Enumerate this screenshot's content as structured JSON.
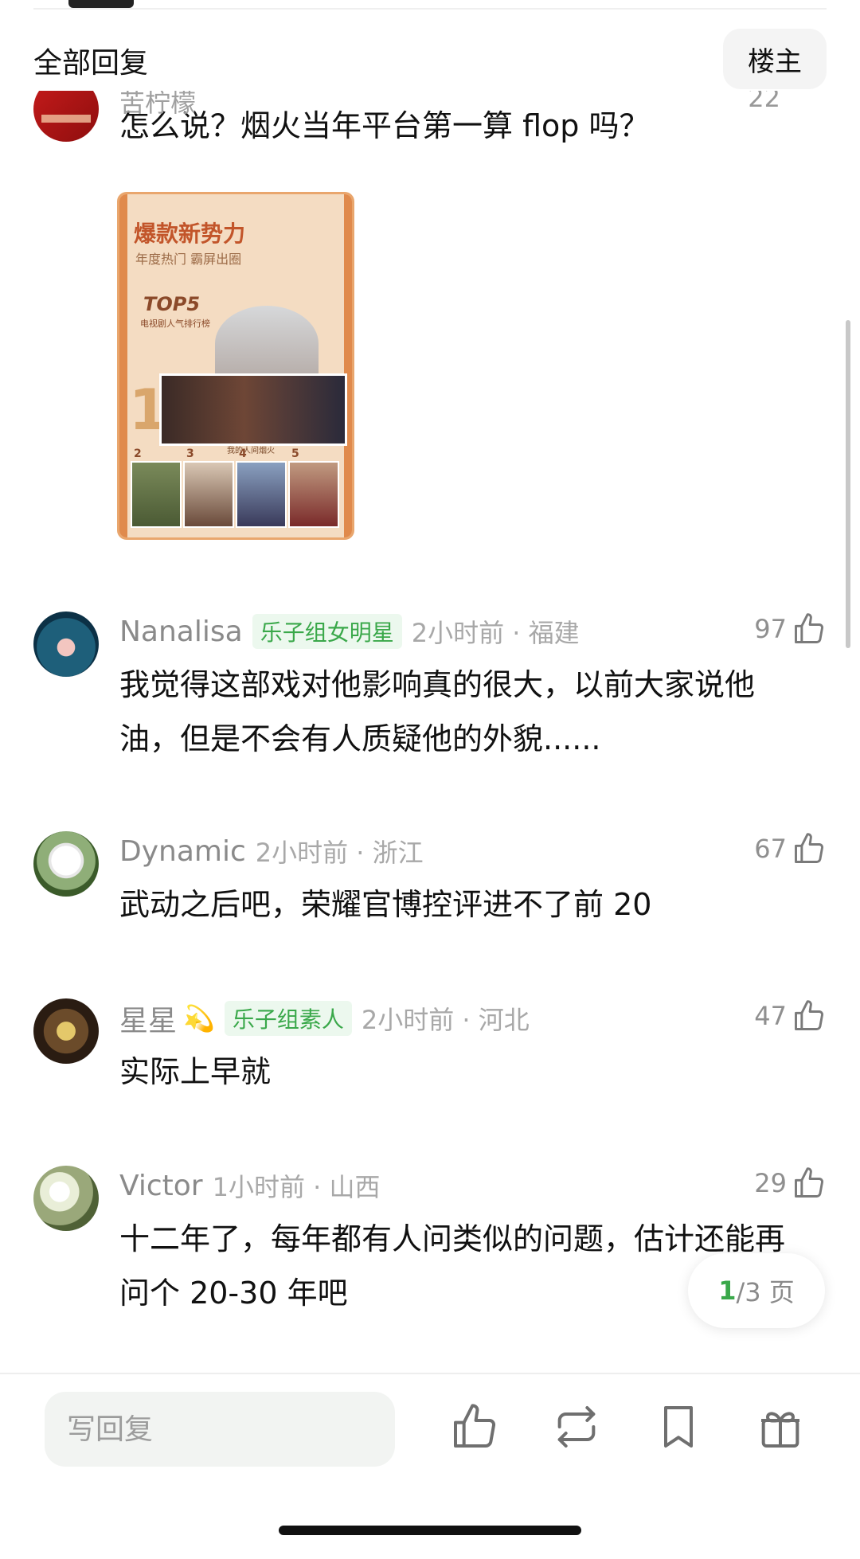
{
  "header": {
    "title": "全部回复",
    "op_button": "楼主"
  },
  "partial_comment": {
    "meta": "苦柠檬",
    "like_count": "22",
    "text": "怎么说？烟火当年平台第一算 flop 吗？"
  },
  "post_image": {
    "headline": "爆款新势力",
    "sub": "年度热门 霸屏出圈",
    "top5": "TOP5",
    "top5sub": "电视剧人气排行榜",
    "rank1_label": "我的人间烟火",
    "ranks": [
      "2",
      "3",
      "4",
      "5"
    ]
  },
  "comments": [
    {
      "user": "Nanalisa",
      "badge": "乐子组女明星",
      "time_loc": "2小时前 · 福建",
      "likes": "97",
      "text": "我觉得这部戏对他影响真的很大，以前大家说他油，但是不会有人质疑他的外貌......"
    },
    {
      "user": "Dynamic",
      "badge": "",
      "time_loc": "2小时前 · 浙江",
      "likes": "67",
      "text": "武动之后吧，荣耀官博控评进不了前 20"
    },
    {
      "user": "星星",
      "emoji": "💫",
      "badge": "乐子组素人",
      "time_loc": "2小时前 · 河北",
      "likes": "47",
      "text": "实际上早就"
    },
    {
      "user": "Victor",
      "badge": "",
      "time_loc": "1小时前 · 山西",
      "likes": "29",
      "text": "十二年了，每年都有人问类似的问题，估计还能再问个 20-30 年吧"
    }
  ],
  "pager": {
    "current": "1",
    "total": "/3 页"
  },
  "reply": {
    "placeholder": "写回复"
  },
  "toolbar": [
    "like-icon",
    "repost-icon",
    "bookmark-icon",
    "gift-icon"
  ],
  "colors": {
    "accent": "#3aa84a",
    "badge_bg": "#ecf8ee",
    "text": "#111111",
    "muted": "#a8a8a8"
  }
}
